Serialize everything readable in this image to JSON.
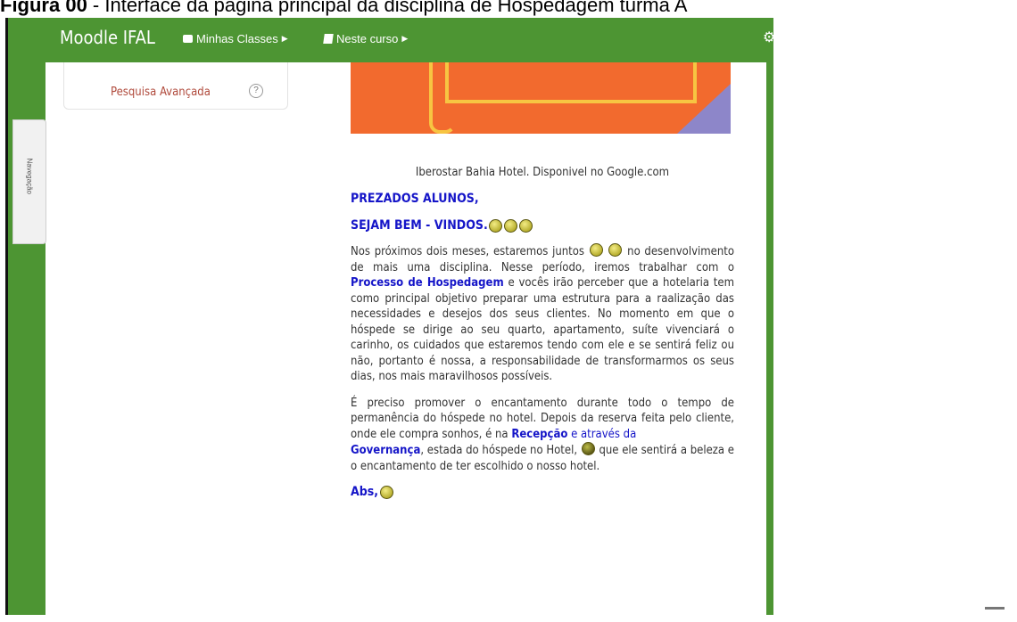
{
  "caption": {
    "label": "Figura 00",
    "text": " - Interface da página principal da disciplina de Hospedagem turma A"
  },
  "header": {
    "brand": "Moodle IFAL",
    "nav": [
      {
        "label": "Minhas Classes"
      },
      {
        "label": "Neste curso"
      }
    ]
  },
  "sidebar": {
    "advanced_search": "Pesquisa Avançada",
    "help": "?",
    "nav_tab": "Navegação"
  },
  "banner": {
    "colors": {
      "background": "#f26a2e",
      "accent": "#f7c542",
      "corner": "#8d86c9"
    }
  },
  "article": {
    "image_credit": "Iberostar Bahia Hotel. Disponivel no Google.com",
    "greeting": "PREZADOS ALUNOS,",
    "welcome": "SEJAM BEM - VINDOS.",
    "p1_a": "Nos próximos dois meses, estaremos juntos",
    "p1_b": "no desenvolvimento de mais uma disciplina. Nesse período, iremos trabalhar com o",
    "p1_link": "Processo de Hospedagem",
    "p1_c": "e vocês irão perceber que a hotelaria tem como principal objetivo preparar uma estrutura para a raalização das necessidades e desejos dos seus clientes. No momento em que o hóspede se dirige ao seu quarto, apartamento, suíte vivenciará o carinho, os cuidados que estaremos tendo com ele e se sentirá feliz ou não, portanto é nossa, a responsabilidade de transformarmos os seus dias, nos mais maravilhosos possíveis.",
    "p2_a": "É preciso promover o encantamento durante todo o tempo de permanência do hóspede no hotel. Depois da reserva feita pelo cliente, onde ele compra sonhos, é na",
    "p2_link1": "Recepção",
    "p2_b": "e através da",
    "p2_link2": "Governança",
    "p2_c": ", estada do hóspede no Hotel,",
    "p2_d": "que ele sentirá a beleza e o encantamento de ter escolhido o nosso hotel.",
    "closing": "Abs,"
  },
  "colors": {
    "theme_green": "#4d9533",
    "link_blue": "#1515c8",
    "sidebar_link": "#b04a3c"
  }
}
